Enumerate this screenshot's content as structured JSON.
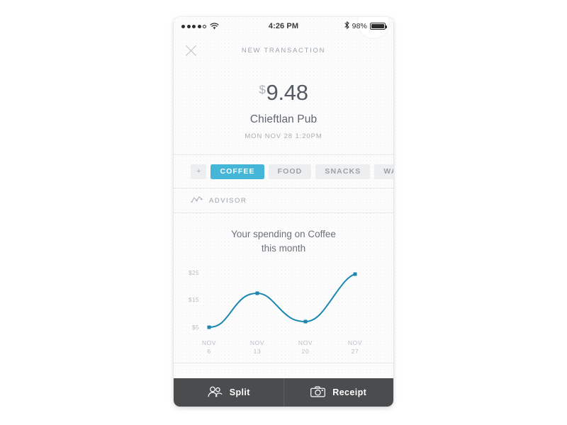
{
  "statusbar": {
    "signal_filled": 4,
    "signal_empty": 1,
    "wifi_icon": "wifi-icon",
    "time": "4:26 PM",
    "bluetooth_icon": "bluetooth-icon",
    "battery_percent": "98%",
    "battery_icon": "battery-icon"
  },
  "navbar": {
    "close_icon": "close-icon",
    "title": "NEW TRANSACTION"
  },
  "transaction": {
    "currency_symbol": "$",
    "amount": "9.48",
    "merchant": "Chieftlan Pub",
    "timestamp": "MON NOV 28 1:20PM"
  },
  "tabs": {
    "add_label": "+",
    "items": [
      {
        "label": "COFFEE",
        "active": true
      },
      {
        "label": "FOOD",
        "active": false
      },
      {
        "label": "SNACKS",
        "active": false
      },
      {
        "label": "WAR",
        "active": false
      }
    ]
  },
  "advisor": {
    "icon": "trend-line-icon",
    "label": "ADVISOR"
  },
  "chart_data": {
    "type": "line",
    "title": "Your spending on Coffee this month",
    "title_line1": "Your spending on Coffee",
    "title_line2": "this month",
    "xlabel": "",
    "ylabel": "",
    "categories": [
      "NOV 6",
      "NOV 13",
      "NOV 20",
      "NOV 27"
    ],
    "x_tick_lines": [
      {
        "line1": "NOV",
        "line2": "6"
      },
      {
        "line1": "NOV",
        "line2": "13"
      },
      {
        "line1": "NOV",
        "line2": "20"
      },
      {
        "line1": "NOV",
        "line2": "27"
      }
    ],
    "values": [
      5,
      17,
      8.5,
      24.5
    ],
    "y_ticks": [
      "$25",
      "$15",
      "$5"
    ],
    "y_tick_values": [
      25,
      15,
      5
    ],
    "ylim": [
      5,
      25
    ],
    "grid": false,
    "legend": false,
    "line_color": "#1b87b0",
    "marker_color": "#1b87b0",
    "curve": "smooth"
  },
  "bottom_bar": {
    "split": {
      "label": "Split",
      "icon": "people-icon"
    },
    "receipt": {
      "label": "Receipt",
      "icon": "camera-icon"
    }
  },
  "colors": {
    "accent": "#45b6d8",
    "chart_line": "#1b87b0",
    "bottom_bar": "#4a4c4e",
    "muted_text": "#9aa0a7"
  }
}
